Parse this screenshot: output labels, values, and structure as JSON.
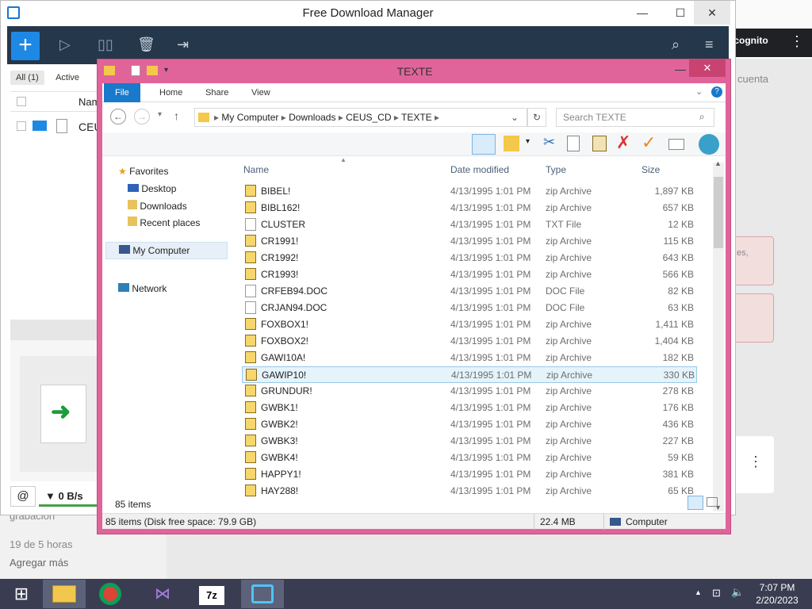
{
  "browser": {
    "incognito_label": "ncognito",
    "right_text": "cuenta",
    "card_text": "es,",
    "bottom_texts": [
      "grabación",
      "19 de 5 horas",
      "Agregar más"
    ]
  },
  "fdm": {
    "title": "Free Download Manager",
    "tabs": [
      "All (1)",
      "Active"
    ],
    "column_name": "Nam",
    "row_name": "CEU",
    "speed": "▼ 0 B/s"
  },
  "explorer": {
    "title": "TEXTE",
    "ribbon_tabs": [
      "File",
      "Home",
      "Share",
      "View"
    ],
    "breadcrumbs": [
      "My Computer",
      "Downloads",
      "CEUS_CD",
      "TEXTE"
    ],
    "search_placeholder": "Search TEXTE",
    "nav": {
      "favorites": "Favorites",
      "desktop": "Desktop",
      "downloads": "Downloads",
      "recent": "Recent places",
      "computer": "My Computer",
      "network": "Network"
    },
    "columns": [
      "Name",
      "Date modified",
      "Type",
      "Size"
    ],
    "files": [
      {
        "name": "BIBEL!",
        "date": "4/13/1995 1:01 PM",
        "type": "zip Archive",
        "size": "1,897 KB",
        "icon": "zip"
      },
      {
        "name": "BIBL162!",
        "date": "4/13/1995 1:01 PM",
        "type": "zip Archive",
        "size": "657 KB",
        "icon": "zip"
      },
      {
        "name": "CLUSTER",
        "date": "4/13/1995 1:01 PM",
        "type": "TXT File",
        "size": "12 KB",
        "icon": "doc"
      },
      {
        "name": "CR1991!",
        "date": "4/13/1995 1:01 PM",
        "type": "zip Archive",
        "size": "115 KB",
        "icon": "zip"
      },
      {
        "name": "CR1992!",
        "date": "4/13/1995 1:01 PM",
        "type": "zip Archive",
        "size": "643 KB",
        "icon": "zip"
      },
      {
        "name": "CR1993!",
        "date": "4/13/1995 1:01 PM",
        "type": "zip Archive",
        "size": "566 KB",
        "icon": "zip"
      },
      {
        "name": "CRFEB94.DOC",
        "date": "4/13/1995 1:01 PM",
        "type": "DOC File",
        "size": "82 KB",
        "icon": "doc"
      },
      {
        "name": "CRJAN94.DOC",
        "date": "4/13/1995 1:01 PM",
        "type": "DOC File",
        "size": "63 KB",
        "icon": "doc"
      },
      {
        "name": "FOXBOX1!",
        "date": "4/13/1995 1:01 PM",
        "type": "zip Archive",
        "size": "1,411 KB",
        "icon": "zip"
      },
      {
        "name": "FOXBOX2!",
        "date": "4/13/1995 1:01 PM",
        "type": "zip Archive",
        "size": "1,404 KB",
        "icon": "zip"
      },
      {
        "name": "GAWI10A!",
        "date": "4/13/1995 1:01 PM",
        "type": "zip Archive",
        "size": "182 KB",
        "icon": "zip"
      },
      {
        "name": "GAWIP10!",
        "date": "4/13/1995 1:01 PM",
        "type": "zip Archive",
        "size": "330 KB",
        "icon": "zip",
        "selected": true
      },
      {
        "name": "GRUNDUR!",
        "date": "4/13/1995 1:01 PM",
        "type": "zip Archive",
        "size": "278 KB",
        "icon": "zip"
      },
      {
        "name": "GWBK1!",
        "date": "4/13/1995 1:01 PM",
        "type": "zip Archive",
        "size": "176 KB",
        "icon": "zip"
      },
      {
        "name": "GWBK2!",
        "date": "4/13/1995 1:01 PM",
        "type": "zip Archive",
        "size": "436 KB",
        "icon": "zip"
      },
      {
        "name": "GWBK3!",
        "date": "4/13/1995 1:01 PM",
        "type": "zip Archive",
        "size": "227 KB",
        "icon": "zip"
      },
      {
        "name": "GWBK4!",
        "date": "4/13/1995 1:01 PM",
        "type": "zip Archive",
        "size": "59 KB",
        "icon": "zip"
      },
      {
        "name": "HAPPY1!",
        "date": "4/13/1995 1:01 PM",
        "type": "zip Archive",
        "size": "381 KB",
        "icon": "zip"
      },
      {
        "name": "HAY288!",
        "date": "4/13/1995 1:01 PM",
        "type": "zip Archive",
        "size": "65 KB",
        "icon": "zip"
      }
    ],
    "item_count": "85 items",
    "status_left": "85 items (Disk free space: 79.9 GB)",
    "status_size": "22.4 MB",
    "status_location": "Computer"
  },
  "taskbar": {
    "time": "7:07 PM",
    "date": "2/20/2023",
    "apps": [
      "file-explorer-icon",
      "chrome-icon",
      "visual-studio-icon",
      "7zip-icon",
      "fdm-icon"
    ]
  }
}
